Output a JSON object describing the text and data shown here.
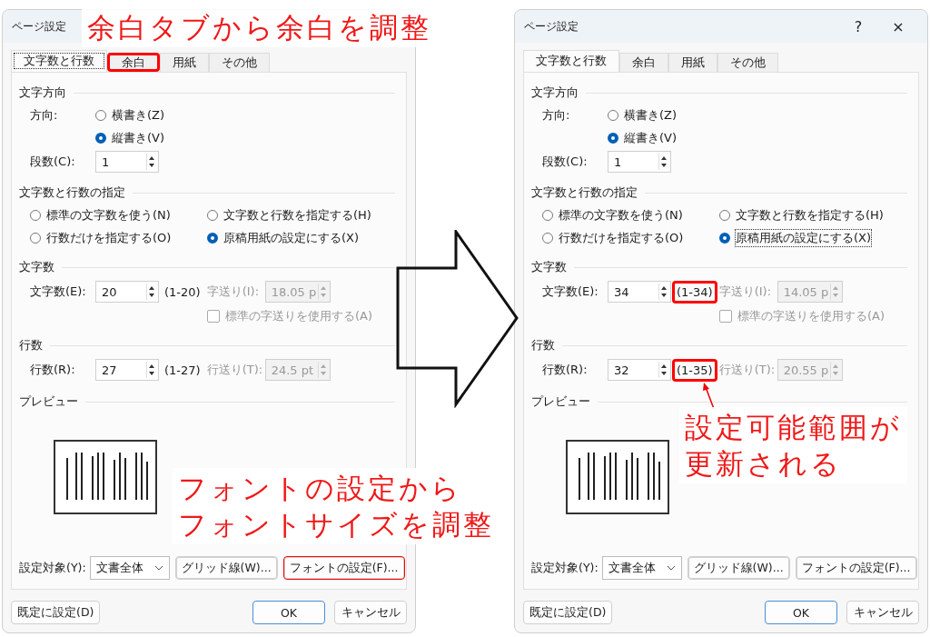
{
  "dialogs": [
    {
      "title": "ページ設定",
      "tabs": [
        {
          "label": "文字数と行数",
          "selected": true,
          "focused": true,
          "highlighted": false
        },
        {
          "label": "余白",
          "selected": false,
          "focused": false,
          "highlighted": true
        },
        {
          "label": "用紙",
          "selected": false,
          "focused": false,
          "highlighted": false
        },
        {
          "label": "その他",
          "selected": false,
          "focused": false,
          "highlighted": false
        }
      ],
      "direction": {
        "heading": "文字方向",
        "label": "方向:",
        "options": [
          {
            "label": "横書き(Z)",
            "selected": false
          },
          {
            "label": "縦書き(V)",
            "selected": true
          }
        ],
        "columns_label": "段数(C):",
        "columns_value": "1"
      },
      "grid_mode": {
        "heading": "文字数と行数の指定",
        "options": [
          {
            "label": "標準の文字数を使う(N)",
            "selected": false,
            "focused": false
          },
          {
            "label": "文字数と行数を指定する(H)",
            "selected": false,
            "focused": false
          },
          {
            "label": "行数だけを指定する(O)",
            "selected": false,
            "focused": false
          },
          {
            "label": "原稿用紙の設定にする(X)",
            "selected": true,
            "focused": false
          }
        ]
      },
      "chars": {
        "heading": "文字数",
        "label": "文字数(E):",
        "value": "20",
        "range": "(1-20)",
        "range_highlighted": false,
        "pitch_label": "字送り(I):",
        "pitch_value": "18.05 p",
        "disabled": true,
        "checkbox": {
          "label": "標準の字送りを使用する(A)",
          "checked": false,
          "disabled": true
        }
      },
      "lines": {
        "heading": "行数",
        "label": "行数(R):",
        "value": "27",
        "range": "(1-27)",
        "range_highlighted": false,
        "pitch_label": "行送り(T):",
        "pitch_value": "24.5 pt",
        "disabled": true
      },
      "preview": {
        "heading": "プレビュー"
      },
      "apply_to": {
        "label": "設定対象(Y):",
        "value": "文書全体"
      },
      "buttons": [
        {
          "label": "グリッド線(W)...",
          "highlighted": false
        },
        {
          "label": "フォントの設定(F)...",
          "highlighted": true
        }
      ],
      "footer_buttons": [
        {
          "label": "既定に設定(D)",
          "kind": "normal"
        },
        {
          "label": "OK",
          "kind": "default"
        },
        {
          "label": "キャンセル",
          "kind": "normal"
        }
      ]
    },
    {
      "title": "ページ設定",
      "help_button": "?",
      "close_button": "×",
      "tabs": [
        {
          "label": "文字数と行数",
          "selected": true,
          "focused": false,
          "highlighted": false
        },
        {
          "label": "余白",
          "selected": false,
          "focused": false,
          "highlighted": false
        },
        {
          "label": "用紙",
          "selected": false,
          "focused": false,
          "highlighted": false
        },
        {
          "label": "その他",
          "selected": false,
          "focused": false,
          "highlighted": false
        }
      ],
      "direction": {
        "heading": "文字方向",
        "label": "方向:",
        "options": [
          {
            "label": "横書き(Z)",
            "selected": false
          },
          {
            "label": "縦書き(V)",
            "selected": true
          }
        ],
        "columns_label": "段数(C):",
        "columns_value": "1"
      },
      "grid_mode": {
        "heading": "文字数と行数の指定",
        "options": [
          {
            "label": "標準の文字数を使う(N)",
            "selected": false,
            "focused": false
          },
          {
            "label": "文字数と行数を指定する(H)",
            "selected": false,
            "focused": false
          },
          {
            "label": "行数だけを指定する(O)",
            "selected": false,
            "focused": false
          },
          {
            "label": "原稿用紙の設定にする(X)",
            "selected": true,
            "focused": true
          }
        ]
      },
      "chars": {
        "heading": "文字数",
        "label": "文字数(E):",
        "value": "34",
        "range": "(1-34)",
        "range_highlighted": true,
        "pitch_label": "字送り(I):",
        "pitch_value": "14.05 p",
        "disabled": true,
        "checkbox": {
          "label": "標準の字送りを使用する(A)",
          "checked": false,
          "disabled": true
        }
      },
      "lines": {
        "heading": "行数",
        "label": "行数(R):",
        "value": "32",
        "range": "(1-35)",
        "range_highlighted": true,
        "pitch_label": "行送り(T):",
        "pitch_value": "20.55 p",
        "disabled": true
      },
      "preview": {
        "heading": "プレビュー"
      },
      "apply_to": {
        "label": "設定対象(Y):",
        "value": "文書全体"
      },
      "buttons": [
        {
          "label": "グリッド線(W)...",
          "highlighted": false
        },
        {
          "label": "フォントの設定(F)...",
          "highlighted": false
        }
      ],
      "footer_buttons": [
        {
          "label": "既定に設定(D)",
          "kind": "normal"
        },
        {
          "label": "OK",
          "kind": "default"
        },
        {
          "label": "キャンセル",
          "kind": "normal"
        }
      ]
    }
  ],
  "annotations": [
    {
      "lines": [
        "余白タブから余白を調整"
      ]
    },
    {
      "lines": [
        "フォントの設定から",
        "フォントサイズを調整"
      ]
    },
    {
      "lines": [
        "設定可能範囲が",
        "更新される"
      ]
    }
  ]
}
